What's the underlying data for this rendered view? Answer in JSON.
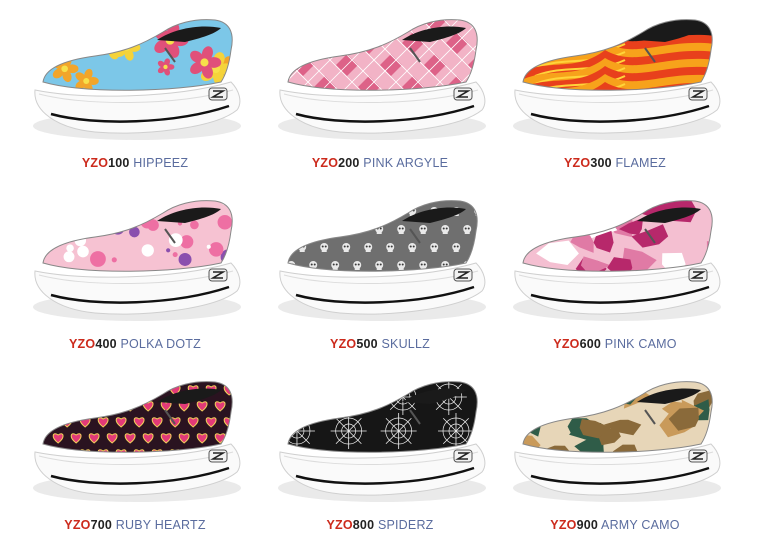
{
  "colors": {
    "code_prefix": "#cc2a1c",
    "code_number": "#222222",
    "name": "#5a6c9e",
    "sole": "#ffffff",
    "sole_line": "#111111"
  },
  "products": [
    {
      "prefix": "YZO",
      "number": "100",
      "name": "HIPPEEZ",
      "colors": [
        "#7cc7e8",
        "#f2a52a",
        "#e0507a",
        "#f5d33a"
      ],
      "pattern": "flowers"
    },
    {
      "prefix": "YZO",
      "number": "200",
      "name": "PINK ARGYLE",
      "colors": [
        "#f2b3c6",
        "#d9537c",
        "#ffffff",
        "#c43e6a"
      ],
      "pattern": "argyle"
    },
    {
      "prefix": "YZO",
      "number": "300",
      "name": "FLAMEZ",
      "colors": [
        "#1a1a1a",
        "#e8401c",
        "#f7a21b",
        "#ffd43a"
      ],
      "pattern": "flames"
    },
    {
      "prefix": "YZO",
      "number": "400",
      "name": "POLKA DOTZ",
      "colors": [
        "#f6c2d2",
        "#ee6fa3",
        "#8a4fae",
        "#ffffff"
      ],
      "pattern": "dots"
    },
    {
      "prefix": "YZO",
      "number": "500",
      "name": "SKULLZ",
      "colors": [
        "#6f6f6f",
        "#e9e9e9",
        "#3a3a3a",
        "#cfcfcf"
      ],
      "pattern": "skulls"
    },
    {
      "prefix": "YZO",
      "number": "600",
      "name": "PINK CAMO",
      "colors": [
        "#f4bfd1",
        "#b7286b",
        "#e07aa5",
        "#ffffff"
      ],
      "pattern": "camo"
    },
    {
      "prefix": "YZO",
      "number": "700",
      "name": "RUBY HEARTZ",
      "colors": [
        "#2a1320",
        "#e23a78",
        "#f2d15a",
        "#9b1e4a"
      ],
      "pattern": "hearts"
    },
    {
      "prefix": "YZO",
      "number": "800",
      "name": "SPIDERZ",
      "colors": [
        "#161616",
        "#f0f0f0",
        "#555555",
        "#999999"
      ],
      "pattern": "webs"
    },
    {
      "prefix": "YZO",
      "number": "900",
      "name": "ARMY CAMO",
      "colors": [
        "#e7d6b8",
        "#8a6a3a",
        "#2f5c48",
        "#c99a5a"
      ],
      "pattern": "camo"
    }
  ]
}
